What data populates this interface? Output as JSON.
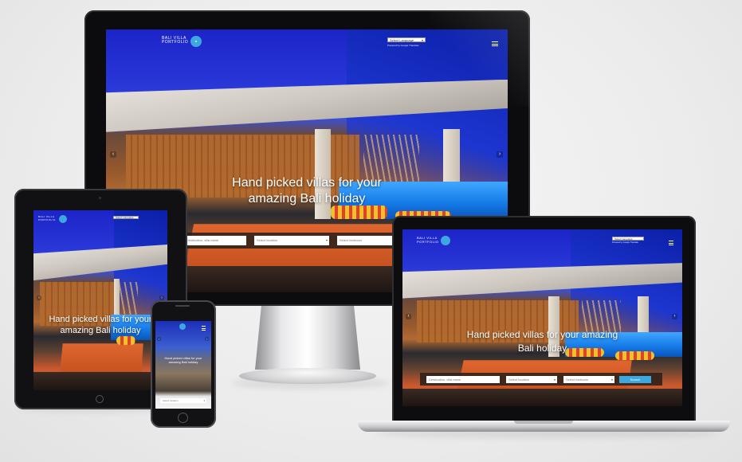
{
  "site": {
    "logo_line1": "BALI VILLA",
    "logo_line2": "PORTFOLIO",
    "logo_badge": "●",
    "language_select": "Select Language",
    "language_caret": "▾",
    "powered_by": "Powered by Google Translate",
    "hero_title": "Hand picked villas for your amazing Bali holiday",
    "prev_arrow": "‹",
    "next_arrow": "›",
    "search": {
      "field1_placeholder": "Destination, villa name",
      "field2_placeholder": "Select location",
      "field3_placeholder": "Select bedroom",
      "button_label": "Search"
    }
  },
  "phone": {
    "hero_text": "Hand picked villas for your amazing Bali holiday",
    "field_placeholder": "Select location"
  },
  "colors": {
    "accent": "#3da8e0",
    "sky": "#1c24c8",
    "lounger": "#d55f2c"
  }
}
